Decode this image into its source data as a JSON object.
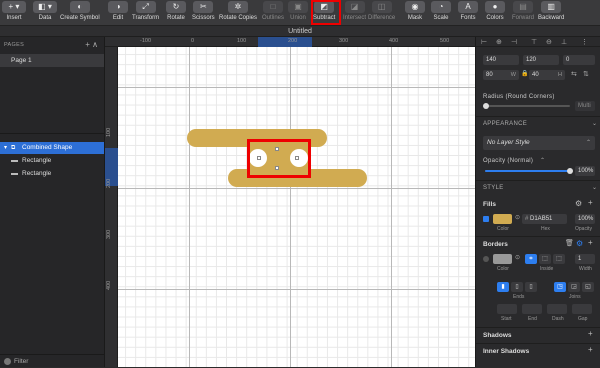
{
  "toolbar": {
    "items": [
      {
        "label": "Insert",
        "icon": "plus-icon",
        "glyph": "+ ▾"
      },
      {
        "label": "Data",
        "icon": "data-icon",
        "glyph": "◧ ▾"
      },
      {
        "label": "Create Symbol",
        "icon": "symbol-icon",
        "glyph": "◐"
      },
      {
        "label": "Edit",
        "icon": "edit-icon",
        "glyph": "◑"
      },
      {
        "label": "Transform",
        "icon": "transform-icon",
        "glyph": "⤢"
      },
      {
        "label": "Rotate",
        "icon": "rotate-icon",
        "glyph": "↻"
      },
      {
        "label": "Scissors",
        "icon": "scissors-icon",
        "glyph": "✂"
      },
      {
        "label": "Rotate Copies",
        "icon": "rotate-copies-icon",
        "glyph": "✲"
      },
      {
        "label": "Outlines",
        "icon": "outlines-icon",
        "glyph": "□"
      },
      {
        "label": "Union",
        "icon": "union-icon",
        "glyph": "▣"
      },
      {
        "label": "Subtract",
        "icon": "subtract-icon",
        "glyph": "◩"
      },
      {
        "label": "Intersect",
        "icon": "intersect-icon",
        "glyph": "◪"
      },
      {
        "label": "Difference",
        "icon": "difference-icon",
        "glyph": "◫"
      },
      {
        "label": "Mask",
        "icon": "mask-icon",
        "glyph": "◉"
      },
      {
        "label": "Scale",
        "icon": "scale-icon",
        "glyph": "◔"
      },
      {
        "label": "Fonts",
        "icon": "fonts-icon",
        "glyph": "A"
      },
      {
        "label": "Colors",
        "icon": "colors-icon",
        "glyph": "●"
      },
      {
        "label": "Forward",
        "icon": "forward-icon",
        "glyph": "▤"
      },
      {
        "label": "Backward",
        "icon": "backward-icon",
        "glyph": "▥"
      }
    ]
  },
  "document": {
    "title": "Untitled"
  },
  "left_panel": {
    "pages_header": "PAGES",
    "pages_buttons": "+ ∧",
    "pages": [
      "Page 1"
    ],
    "layers": [
      {
        "label": "Combined Shape",
        "selected": true
      },
      {
        "label": "Rectangle",
        "selected": false
      },
      {
        "label": "Rectangle",
        "selected": false
      }
    ],
    "filter_label": "Filter"
  },
  "rulers": {
    "top": [
      "-100",
      "0",
      "100",
      "200",
      "300",
      "400",
      "500"
    ],
    "left": [
      "100",
      "200",
      "300",
      "400"
    ]
  },
  "canvas": {
    "shape_color": "#D1AB51"
  },
  "inspector": {
    "x": "140",
    "y": "120",
    "rotation": "0",
    "width": "80",
    "width_suffix": "W",
    "height": "40",
    "height_suffix": "H",
    "lock_icon": "🔒",
    "radius_label": "Radius (Round Corners)",
    "radius_value": "Multi",
    "appearance_header": "APPEARANCE",
    "layer_style": "No Layer Style",
    "opacity_label": "Opacity (Normal)",
    "opacity_value": "100%",
    "opacity_fraction": 1.0,
    "style_header": "STYLE",
    "fills_label": "Fills",
    "fill_hex": "D1AB51",
    "fill_hash": "#",
    "fill_opacity": "100%",
    "fill_col_color": "Color",
    "fill_col_hex": "Hex",
    "fill_col_opacity": "Opacity",
    "borders_label": "Borders",
    "border_width": "1",
    "border_col_color": "Color",
    "border_col_inside": "Inside",
    "border_col_width": "Width",
    "ends_label": "Ends",
    "joins_label": "Joins",
    "start_label": "Start",
    "end_label": "End",
    "dash_label": "Dash",
    "gap_label": "Gap",
    "shadows_label": "Shadows",
    "inner_shadows_label": "Inner Shadows"
  }
}
